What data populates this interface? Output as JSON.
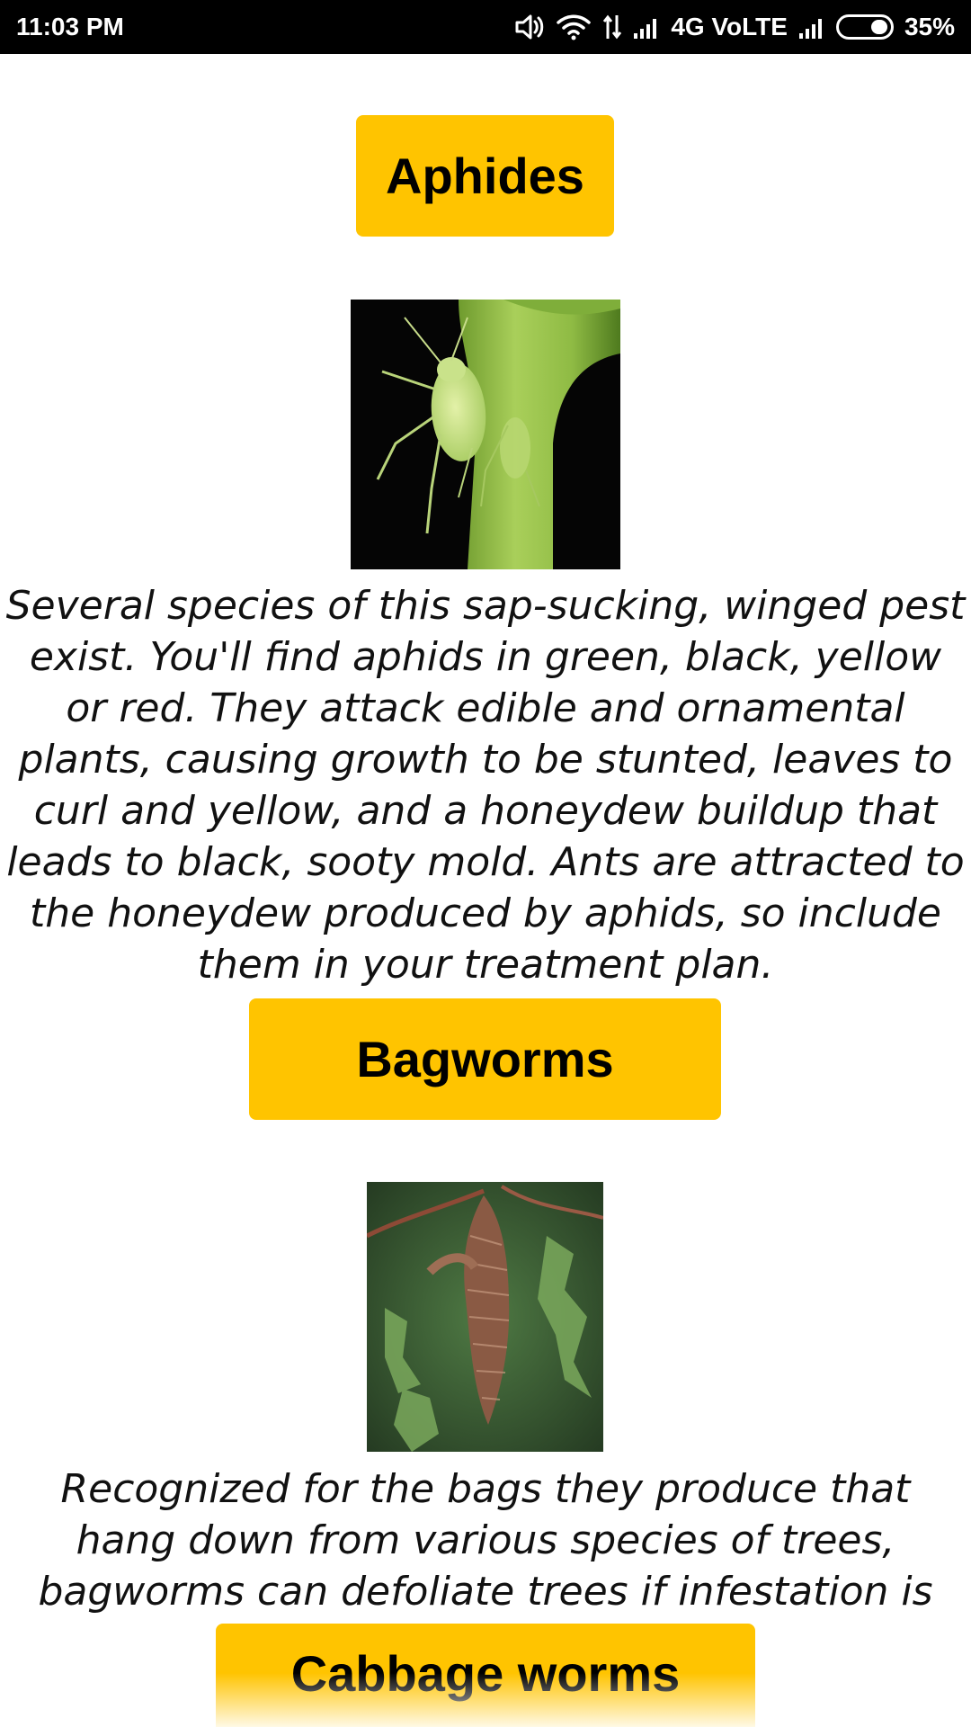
{
  "status_bar": {
    "time": "11:03 PM",
    "network_label": "4G VoLTE",
    "battery_percent": "35%",
    "battery_level": 0.35,
    "icons": [
      "volume-icon",
      "wifi-icon",
      "data-arrows-icon",
      "signal-icon",
      "signal-icon",
      "battery-icon"
    ]
  },
  "pests": [
    {
      "name": "Aphides",
      "image_icon": "aphid-photo",
      "description": "Several species of this sap-sucking, winged pest exist.  You'll find aphids in green, black, yellow or red. They attack edible and ornamental plants, causing growth to be stunted, leaves to curl and yellow, and a honeydew buildup that leads to black, sooty mold. Ants are attracted to the honeydew produced by aphids, so include them in your treatment plan."
    },
    {
      "name": "Bagworms",
      "image_icon": "bagworm-photo",
      "description": "Recognized for the bags they produce that hang down from various species of trees,  bagworms can defoliate trees if infestation is heavy."
    },
    {
      "name": "Cabbage worms"
    }
  ],
  "colors": {
    "button_bg": "#ffc400",
    "status_bar_bg": "#000000"
  }
}
